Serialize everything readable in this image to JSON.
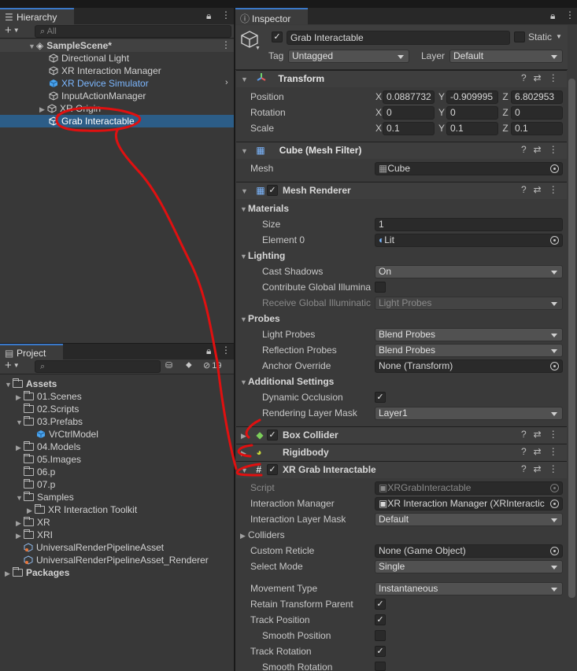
{
  "hierarchy": {
    "tab_label": "Hierarchy",
    "add_label": "+",
    "search_placeholder": "All",
    "scene_name": "SampleScene*",
    "items": [
      {
        "label": "Directional Light"
      },
      {
        "label": "XR Interaction Manager"
      },
      {
        "label": "XR Device Simulator"
      },
      {
        "label": "InputActionManager"
      },
      {
        "label": "XR Origin"
      },
      {
        "label": "Grab Interactable"
      }
    ]
  },
  "project": {
    "tab_label": "Project",
    "add_label": "+",
    "hidden_count": "19",
    "tree": [
      {
        "label": "Assets"
      },
      {
        "label": "01.Scenes"
      },
      {
        "label": "02.Scripts"
      },
      {
        "label": "03.Prefabs"
      },
      {
        "label": "VrCtrlModel"
      },
      {
        "label": "04.Models"
      },
      {
        "label": "05.Images"
      },
      {
        "label": "06.p"
      },
      {
        "label": "07.p"
      },
      {
        "label": "Samples"
      },
      {
        "label": "XR Interaction Toolkit"
      },
      {
        "label": "XR"
      },
      {
        "label": "XRI"
      },
      {
        "label": "UniversalRenderPipelineAsset"
      },
      {
        "label": "UniversalRenderPipelineAsset_Renderer"
      },
      {
        "label": "Packages"
      }
    ]
  },
  "inspector": {
    "tab_label": "Inspector",
    "object_name": "Grab Interactable",
    "static_label": "Static",
    "tag_label": "Tag",
    "tag_value": "Untagged",
    "layer_label": "Layer",
    "layer_value": "Default",
    "transform": {
      "title": "Transform",
      "position_label": "Position",
      "rotation_label": "Rotation",
      "scale_label": "Scale",
      "x": "X",
      "y": "Y",
      "z": "Z",
      "position": [
        "0.0887732",
        "-0.909995",
        "6.802953"
      ],
      "rotation": [
        "0",
        "0",
        "0"
      ],
      "scale": [
        "0.1",
        "0.1",
        "0.1"
      ]
    },
    "mesh_filter": {
      "title": "Cube (Mesh Filter)",
      "mesh_label": "Mesh",
      "mesh_value": "Cube"
    },
    "mesh_renderer": {
      "title": "Mesh Renderer",
      "materials_label": "Materials",
      "size_label": "Size",
      "size_value": "1",
      "element0_label": "Element 0",
      "element0_value": "Lit",
      "lighting_label": "Lighting",
      "cast_shadows_label": "Cast Shadows",
      "cast_shadows_value": "On",
      "contribute_gi_label": "Contribute Global Illumina",
      "receive_gi_label": "Receive Global Illuminatic",
      "receive_gi_value": "Light Probes",
      "probes_label": "Probes",
      "light_probes_label": "Light Probes",
      "light_probes_value": "Blend Probes",
      "reflection_probes_label": "Reflection Probes",
      "reflection_probes_value": "Blend Probes",
      "anchor_override_label": "Anchor Override",
      "anchor_override_value": "None (Transform)",
      "additional_label": "Additional Settings",
      "dynamic_occlusion_label": "Dynamic Occlusion",
      "rendering_layer_label": "Rendering Layer Mask",
      "rendering_layer_value": "Layer1"
    },
    "box_collider": {
      "title": "Box Collider"
    },
    "rigidbody": {
      "title": "Rigidbody"
    },
    "xr_grab": {
      "title": "XR Grab Interactable",
      "script_label": "Script",
      "script_value": "XRGrabInteractable",
      "interaction_manager_label": "Interaction Manager",
      "interaction_manager_value": "XR Interaction Manager (XRInteractic",
      "interaction_layer_label": "Interaction Layer Mask",
      "interaction_layer_value": "Default",
      "colliders_label": "Colliders",
      "custom_reticle_label": "Custom Reticle",
      "custom_reticle_value": "None (Game Object)",
      "select_mode_label": "Select Mode",
      "select_mode_value": "Single",
      "movement_type_label": "Movement Type",
      "movement_type_value": "Instantaneous",
      "retain_parent_label": "Retain Transform Parent",
      "track_position_label": "Track Position",
      "smooth_position_label": "Smooth Position",
      "track_rotation_label": "Track Rotation",
      "smooth_rotation_label": "Smooth Rotation"
    }
  },
  "colors": {
    "selection": "#2c5d87",
    "annotation": "#e01010",
    "prefab_blue": "#6fb0ff"
  }
}
